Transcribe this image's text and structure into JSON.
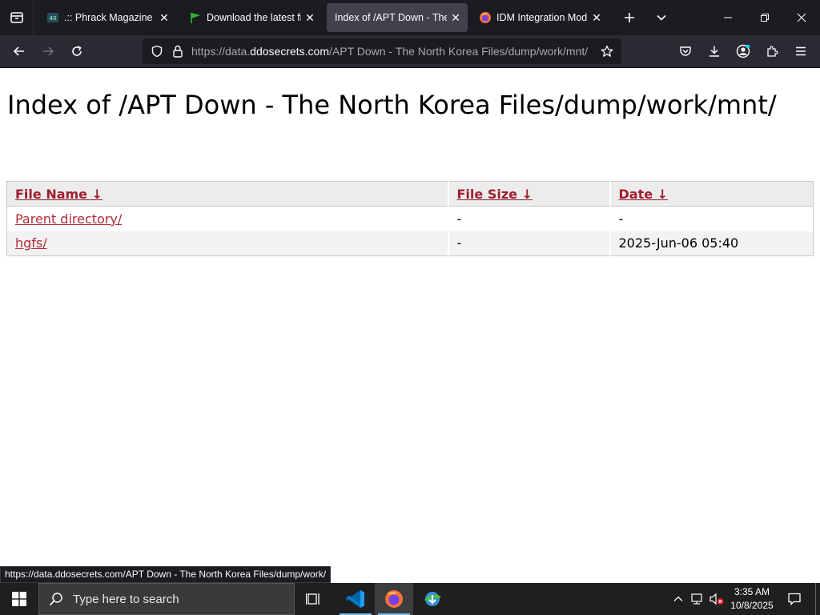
{
  "browser": {
    "tabs": [
      {
        "title": ".:: Phrack Magazine ::.",
        "favicon": "phrack-icon",
        "active": false
      },
      {
        "title": "Download the latest free",
        "favicon": "green-flag-icon",
        "active": false
      },
      {
        "title": "Index of /APT Down - The N",
        "favicon": "none",
        "active": true
      },
      {
        "title": "IDM Integration Module",
        "favicon": "firefox-icon",
        "active": false
      }
    ],
    "url": {
      "scheme": "https://data.",
      "domain": "ddosecrets.com",
      "path": "/APT Down - The North Korea Files/dump/work/mnt/"
    }
  },
  "page": {
    "title": "Index of /APT Down - The North Korea Files/dump/work/mnt/",
    "table": {
      "headers": [
        "File Name  ↓",
        "File Size  ↓",
        "Date  ↓"
      ],
      "rows": [
        {
          "name": "Parent directory/",
          "size": "-",
          "date": "-"
        },
        {
          "name": "hgfs/",
          "size": "-",
          "date": "2025-Jun-06 05:40"
        }
      ]
    }
  },
  "status_bar": {
    "link": "https://data.ddosecrets.com/APT Down - The North Korea Files/dump/work/"
  },
  "taskbar": {
    "search_placeholder": "Type here to search",
    "time": "3:35 AM",
    "date": "10/8/2025"
  },
  "colors": {
    "tabbar": "#1c1b22",
    "navbar": "#2b2a33",
    "link": "#b12a35",
    "header_link": "#9e1f2e"
  }
}
